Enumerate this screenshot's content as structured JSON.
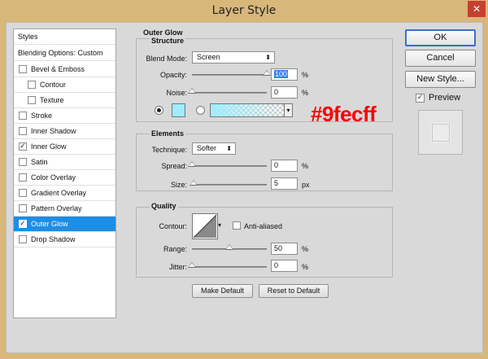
{
  "window": {
    "title": "Layer Style",
    "close_glyph": "✕"
  },
  "sidebar": {
    "header": "Styles",
    "blending": "Blending Options: Custom",
    "items": [
      {
        "label": "Bevel & Emboss",
        "checked": false,
        "sub": false
      },
      {
        "label": "Contour",
        "checked": false,
        "sub": true
      },
      {
        "label": "Texture",
        "checked": false,
        "sub": true
      },
      {
        "label": "Stroke",
        "checked": false,
        "sub": false
      },
      {
        "label": "Inner Shadow",
        "checked": false,
        "sub": false
      },
      {
        "label": "Inner Glow",
        "checked": true,
        "sub": false
      },
      {
        "label": "Satin",
        "checked": false,
        "sub": false
      },
      {
        "label": "Color Overlay",
        "checked": false,
        "sub": false
      },
      {
        "label": "Gradient Overlay",
        "checked": false,
        "sub": false
      },
      {
        "label": "Pattern Overlay",
        "checked": false,
        "sub": false
      },
      {
        "label": "Outer Glow",
        "checked": true,
        "sub": false,
        "selected": true
      },
      {
        "label": "Drop Shadow",
        "checked": false,
        "sub": false
      }
    ]
  },
  "panel": {
    "title": "Outer Glow",
    "structure": {
      "title": "Structure",
      "blend_mode_label": "Blend Mode:",
      "blend_mode_value": "Screen",
      "opacity_label": "Opacity:",
      "opacity_value": "100",
      "opacity_unit": "%",
      "opacity_level": 1.0,
      "noise_label": "Noise:",
      "noise_value": "0",
      "noise_unit": "%",
      "noise_level": 0.0,
      "glow_color": "#9fecff"
    },
    "elements": {
      "title": "Elements",
      "technique_label": "Technique:",
      "technique_value": "Softer",
      "spread_label": "Spread:",
      "spread_value": "0",
      "spread_unit": "%",
      "spread_level": 0.0,
      "size_label": "Size:",
      "size_value": "5",
      "size_unit": "px",
      "size_level": 0.02
    },
    "quality": {
      "title": "Quality",
      "contour_label": "Contour:",
      "anti_aliased_label": "Anti-aliased",
      "range_label": "Range:",
      "range_value": "50",
      "range_unit": "%",
      "range_level": 0.5,
      "jitter_label": "Jitter:",
      "jitter_value": "0",
      "jitter_unit": "%",
      "jitter_level": 0.0
    },
    "make_default": "Make Default",
    "reset_default": "Reset to Default"
  },
  "annotation": {
    "hex_text": "#9fecff",
    "color": "#ff0000"
  },
  "buttons": {
    "ok": "OK",
    "cancel": "Cancel",
    "new_style": "New Style...",
    "preview_label": "Preview",
    "preview_checked": true
  },
  "colors": {
    "selection": "#1e8de4",
    "glow": "#9fecff"
  }
}
